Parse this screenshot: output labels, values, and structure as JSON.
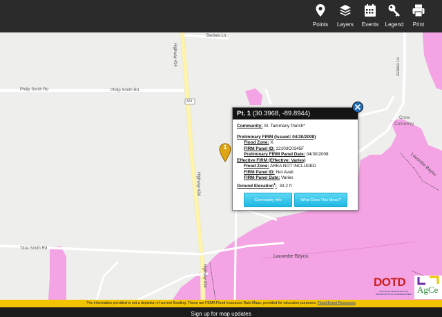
{
  "toolbar": {
    "items": [
      {
        "label": "Points",
        "icon": "map-pin-icon"
      },
      {
        "label": "Layers",
        "icon": "layers-icon"
      },
      {
        "label": "Events",
        "icon": "calendar-icon"
      },
      {
        "label": "Legend",
        "icon": "key-icon"
      },
      {
        "label": "Print",
        "icon": "printer-icon"
      }
    ]
  },
  "map": {
    "flood_zone_color": "#f4a3e4",
    "road_labels": {
      "backes": "Backes Ln",
      "philip_smith_left": "Philip Smith Rd",
      "philip_smith_mid": "Philip Smith Rd",
      "highway_top": "Highway 434",
      "highway_mid": "Highway 434",
      "highway_bottom": "Highway 434",
      "shield_434": "434",
      "titus_smith": "Titus Smith Rd",
      "lacombe_bayou": "Lacombe Bayou",
      "lacombe_bayou_right": "Lacombe Bayou",
      "crow_cemetery_1": "Crow",
      "crow_cemetery_2": "Cemetery",
      "azalea": "Azalea Ln"
    },
    "marker_number": "1"
  },
  "popup": {
    "title": "Pt. 1",
    "coords": "(30.3968, -89.8944)",
    "community_label": "Community:",
    "community_value": "St. Tammany Parish*",
    "prelim_heading": "Preliminary FIRM (Issued:  04/30/2008)",
    "prelim_zone_label": "Flood Zone:",
    "prelim_zone_value": "X",
    "prelim_panel_label": "FIRM Panel ID:",
    "prelim_panel_value": "22103C0345F",
    "prelim_date_label": "Preliminary FIRM Panel Date:",
    "prelim_date_value": "04/30/2008",
    "eff_heading": "Effective FIRM (Effective:  Varies)",
    "eff_zone_label": "Flood Zone:",
    "eff_zone_value": "AREA NOT INCLUDED",
    "eff_panel_label": "FIRM Panel ID:",
    "eff_panel_value": "Not Avail",
    "eff_date_label": "FIRM Panel Date:",
    "eff_date_value": "Varies",
    "elev_label": "Ground Elevation",
    "elev_sup": "1",
    "elev_colon": ":",
    "elev_value": "33.2 ft",
    "btn_community": "Community Info",
    "btn_what": "What Does This Mean?"
  },
  "logos": {
    "dotd": "DOTD",
    "dotd_sub": "LOUISIANA DEPARTMENT OF TRANSPORTATION & DEVELOPMENT",
    "agcenter": "AgCe"
  },
  "notice": {
    "text": "The information provided is not a depiction of current flooding. These are FEMA Flood Insurance Rate Maps, provided for education purposes.",
    "link": "Flood Event Resources"
  },
  "footer": {
    "text": "Sign up for map updates"
  }
}
